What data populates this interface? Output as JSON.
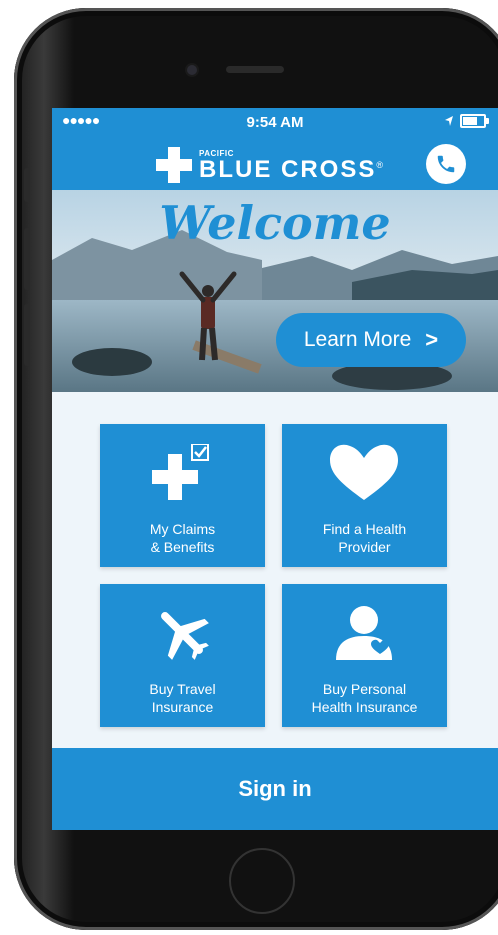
{
  "status_bar": {
    "signal": "●●●●●",
    "time": "9:54 AM"
  },
  "header": {
    "brand_small": "PACIFIC",
    "brand_big": "BLUE CROSS",
    "brand_mark": "®",
    "phone_icon": "phone-icon"
  },
  "hero": {
    "title": "Welcome",
    "learn_more_label": "Learn More",
    "learn_more_chevron": ">"
  },
  "tiles": [
    {
      "label": "My Claims\n& Benefits",
      "icon": "medical-cross-check-icon"
    },
    {
      "label": "Find a Health\nProvider",
      "icon": "heart-icon"
    },
    {
      "label": "Buy Travel\nInsurance",
      "icon": "airplane-icon"
    },
    {
      "label": "Buy Personal\nHealth Insurance",
      "icon": "person-heart-icon"
    }
  ],
  "sign_in": {
    "label": "Sign in"
  },
  "colors": {
    "brand_blue": "#1f8fd4",
    "background": "#eef5fa"
  }
}
